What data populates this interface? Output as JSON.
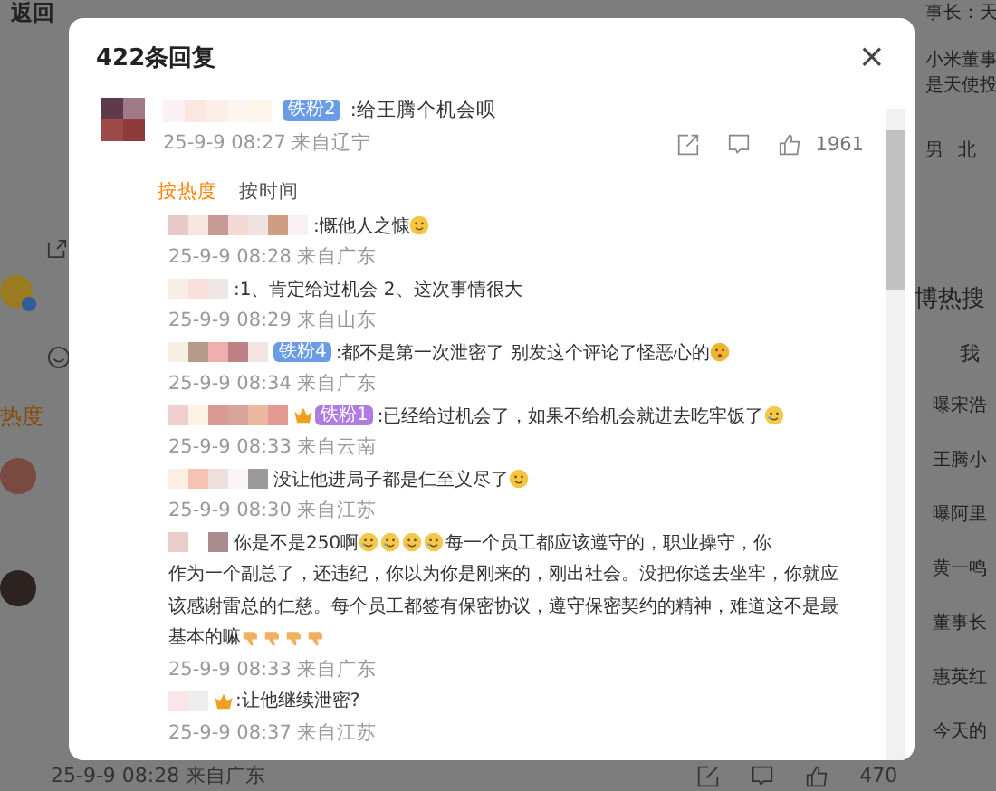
{
  "background": {
    "back_label": "返回",
    "snippets": [
      "事长：天",
      "小米董事",
      "是天使投"
    ],
    "profile": [
      "男",
      "北"
    ],
    "sort_label": "热度",
    "hot_title": "博热搜",
    "my_label": "我",
    "hot_items": [
      "曝宋浩",
      "王腾小",
      "曝阿里",
      "黄一鸣",
      "董事长",
      "惠英红",
      "今天的"
    ],
    "footer_time": "25-9-9 08:28 来自广东",
    "footer_count": "470"
  },
  "dialog": {
    "title": "422条回复",
    "close": "×",
    "comment": {
      "badge": {
        "text": "铁粉2",
        "color": "#6a9be6"
      },
      "text": ":给王腾个机会呗",
      "time": "25-9-9 08:27 来自辽宁",
      "likes": "1961"
    },
    "sort_tabs": [
      {
        "label": "按热度",
        "selected": true
      },
      {
        "label": "按时间",
        "selected": false
      }
    ],
    "replies": [
      {
        "lines": [
          [
            {
              "kind": "text",
              "text": ":慨他人之慷"
            },
            {
              "kind": "grin"
            }
          ]
        ],
        "time": "25-9-9 08:28 来自广东"
      },
      {
        "lines": [
          [
            {
              "kind": "text",
              "text": ":1、肯定给过机会 2、这次事情很大"
            }
          ]
        ],
        "time": "25-9-9 08:29 来自山东"
      },
      {
        "lines": [
          [
            {
              "kind": "badge",
              "text": "铁粉4",
              "color": "#6a9be6"
            },
            {
              "kind": "text",
              "text": ":都不是第一次泄密了 别发这个评论了怪恶心的"
            },
            {
              "kind": "shock"
            }
          ]
        ],
        "time": "25-9-9 08:34 来自广东"
      },
      {
        "lines": [
          [
            {
              "kind": "crown"
            },
            {
              "kind": "badge",
              "text": "铁粉1",
              "color": "#b07ae0"
            },
            {
              "kind": "text",
              "text": ":已经给过机会了，如果不给机会就进去吃牢饭了"
            },
            {
              "kind": "cry"
            }
          ]
        ],
        "time": "25-9-9 08:33 来自云南"
      },
      {
        "lines": [
          [
            {
              "kind": "text",
              "text": "没让他进局子都是仁至义尽了"
            },
            {
              "kind": "smile"
            }
          ]
        ],
        "time": "25-9-9 08:30 来自江苏"
      },
      {
        "lines": [
          [
            {
              "kind": "text",
              "text": "你是不是250啊"
            },
            {
              "kind": "cry"
            },
            {
              "kind": "cry"
            },
            {
              "kind": "cry"
            },
            {
              "kind": "cry"
            },
            {
              "kind": "text",
              "text": "每一个员工都应该遵守的，职业操守，你"
            }
          ],
          [
            {
              "kind": "text",
              "text": "作为一个副总了，还违纪，你以为你是刚来的，刚出社会。没把你送去坐牢，你就应"
            }
          ],
          [
            {
              "kind": "text",
              "text": "该感谢雷总的仁慈。每个员工都签有保密协议，遵守保密契约的精神，难道这不是最"
            }
          ],
          [
            {
              "kind": "text",
              "text": "基本的嘛"
            },
            {
              "kind": "thumbsdown"
            },
            {
              "kind": "thumbsdown"
            },
            {
              "kind": "thumbsdown"
            },
            {
              "kind": "thumbsdown"
            }
          ]
        ],
        "time": "25-9-9 08:33 来自广东"
      },
      {
        "lines": [
          [
            {
              "kind": "crown"
            },
            {
              "kind": "text",
              "text": ":让他继续泄密?"
            }
          ]
        ],
        "time": "25-9-9 08:37 来自江苏"
      }
    ]
  }
}
